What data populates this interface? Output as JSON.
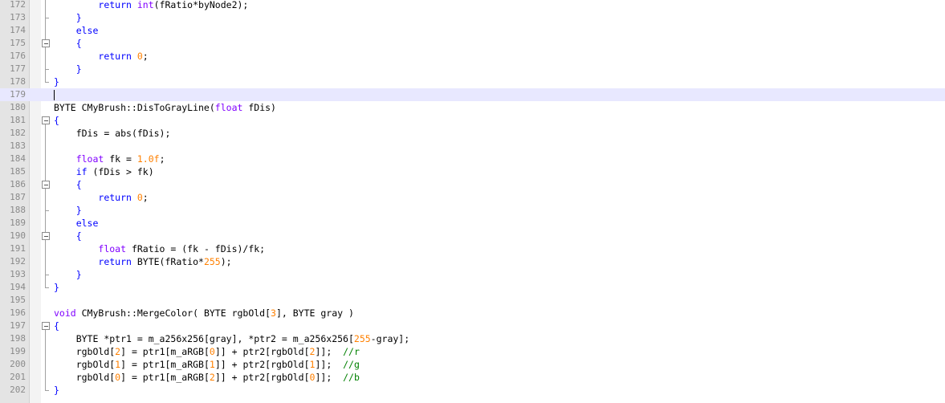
{
  "colors": {
    "keyword": "#0000ff",
    "type_keyword": "#8000ff",
    "number": "#ff8000",
    "comment": "#008000",
    "current_line": "#e8e8ff",
    "gutter": "#e4e4e4"
  },
  "current_line_number": "179",
  "lines": [
    {
      "n": "172",
      "fold": "line",
      "indent": "        ",
      "tokens": [
        {
          "t": "return ",
          "c": "kw"
        },
        {
          "t": "int",
          "c": "kwt"
        },
        {
          "t": "(fRatio*byNode2);",
          "c": "plain"
        }
      ]
    },
    {
      "n": "173",
      "fold": "end",
      "indent": "    ",
      "tokens": [
        {
          "t": "}",
          "c": "kw"
        }
      ]
    },
    {
      "n": "174",
      "fold": "line",
      "indent": "    ",
      "tokens": [
        {
          "t": "else",
          "c": "kw"
        }
      ]
    },
    {
      "n": "175",
      "fold": "box",
      "indent": "    ",
      "tokens": [
        {
          "t": "{",
          "c": "kw"
        }
      ]
    },
    {
      "n": "176",
      "fold": "line",
      "indent": "        ",
      "tokens": [
        {
          "t": "return ",
          "c": "kw"
        },
        {
          "t": "0",
          "c": "num"
        },
        {
          "t": ";",
          "c": "plain"
        }
      ]
    },
    {
      "n": "177",
      "fold": "end",
      "indent": "    ",
      "tokens": [
        {
          "t": "}",
          "c": "kw"
        }
      ]
    },
    {
      "n": "178",
      "fold": "endtop",
      "indent": "",
      "tokens": [
        {
          "t": "}",
          "c": "kw"
        }
      ]
    },
    {
      "n": "179",
      "fold": "none",
      "indent": "",
      "tokens": []
    },
    {
      "n": "180",
      "fold": "none",
      "indent": "",
      "tokens": [
        {
          "t": "BYTE CMyBrush::DisToGrayLine(",
          "c": "plain"
        },
        {
          "t": "float",
          "c": "kwt"
        },
        {
          "t": " fDis)",
          "c": "plain"
        }
      ]
    },
    {
      "n": "181",
      "fold": "boxtop",
      "indent": "",
      "tokens": [
        {
          "t": "{",
          "c": "kw"
        }
      ]
    },
    {
      "n": "182",
      "fold": "line",
      "indent": "    ",
      "tokens": [
        {
          "t": "fDis = abs(fDis);",
          "c": "plain"
        }
      ]
    },
    {
      "n": "183",
      "fold": "line",
      "indent": "",
      "tokens": []
    },
    {
      "n": "184",
      "fold": "line",
      "indent": "    ",
      "tokens": [
        {
          "t": "float",
          "c": "kwt"
        },
        {
          "t": " fk = ",
          "c": "plain"
        },
        {
          "t": "1.0f",
          "c": "num"
        },
        {
          "t": ";",
          "c": "plain"
        }
      ]
    },
    {
      "n": "185",
      "fold": "line",
      "indent": "    ",
      "tokens": [
        {
          "t": "if",
          "c": "kw"
        },
        {
          "t": " (fDis > fk)",
          "c": "plain"
        }
      ]
    },
    {
      "n": "186",
      "fold": "box",
      "indent": "    ",
      "tokens": [
        {
          "t": "{",
          "c": "kw"
        }
      ]
    },
    {
      "n": "187",
      "fold": "line",
      "indent": "        ",
      "tokens": [
        {
          "t": "return ",
          "c": "kw"
        },
        {
          "t": "0",
          "c": "num"
        },
        {
          "t": ";",
          "c": "plain"
        }
      ]
    },
    {
      "n": "188",
      "fold": "end",
      "indent": "    ",
      "tokens": [
        {
          "t": "}",
          "c": "kw"
        }
      ]
    },
    {
      "n": "189",
      "fold": "line",
      "indent": "    ",
      "tokens": [
        {
          "t": "else",
          "c": "kw"
        }
      ]
    },
    {
      "n": "190",
      "fold": "box",
      "indent": "    ",
      "tokens": [
        {
          "t": "{",
          "c": "kw"
        }
      ]
    },
    {
      "n": "191",
      "fold": "line",
      "indent": "        ",
      "tokens": [
        {
          "t": "float",
          "c": "kwt"
        },
        {
          "t": " fRatio = (fk - fDis)/fk;",
          "c": "plain"
        }
      ]
    },
    {
      "n": "192",
      "fold": "line",
      "indent": "        ",
      "tokens": [
        {
          "t": "return",
          "c": "kw"
        },
        {
          "t": " BYTE(fRatio*",
          "c": "plain"
        },
        {
          "t": "255",
          "c": "num"
        },
        {
          "t": ");",
          "c": "plain"
        }
      ]
    },
    {
      "n": "193",
      "fold": "end",
      "indent": "    ",
      "tokens": [
        {
          "t": "}",
          "c": "kw"
        }
      ]
    },
    {
      "n": "194",
      "fold": "endtop",
      "indent": "",
      "tokens": [
        {
          "t": "}",
          "c": "kw"
        }
      ]
    },
    {
      "n": "195",
      "fold": "none",
      "indent": "",
      "tokens": []
    },
    {
      "n": "196",
      "fold": "none",
      "indent": "",
      "tokens": [
        {
          "t": "void",
          "c": "kwt"
        },
        {
          "t": " CMyBrush::MergeColor( BYTE rgbOld[",
          "c": "plain"
        },
        {
          "t": "3",
          "c": "num"
        },
        {
          "t": "], BYTE gray )",
          "c": "plain"
        }
      ]
    },
    {
      "n": "197",
      "fold": "boxtop",
      "indent": "",
      "tokens": [
        {
          "t": "{",
          "c": "kw"
        }
      ]
    },
    {
      "n": "198",
      "fold": "line",
      "indent": "    ",
      "tokens": [
        {
          "t": "BYTE *ptr1 = m_a256x256[gray], *ptr2 = m_a256x256[",
          "c": "plain"
        },
        {
          "t": "255",
          "c": "num"
        },
        {
          "t": "-gray];",
          "c": "plain"
        }
      ]
    },
    {
      "n": "199",
      "fold": "line",
      "indent": "    ",
      "tokens": [
        {
          "t": "rgbOld[",
          "c": "plain"
        },
        {
          "t": "2",
          "c": "num"
        },
        {
          "t": "] = ptr1[m_aRGB[",
          "c": "plain"
        },
        {
          "t": "0",
          "c": "num"
        },
        {
          "t": "]] + ptr2[rgbOld[",
          "c": "plain"
        },
        {
          "t": "2",
          "c": "num"
        },
        {
          "t": "]];  ",
          "c": "plain"
        },
        {
          "t": "//r",
          "c": "cmt"
        }
      ]
    },
    {
      "n": "200",
      "fold": "line",
      "indent": "    ",
      "tokens": [
        {
          "t": "rgbOld[",
          "c": "plain"
        },
        {
          "t": "1",
          "c": "num"
        },
        {
          "t": "] = ptr1[m_aRGB[",
          "c": "plain"
        },
        {
          "t": "1",
          "c": "num"
        },
        {
          "t": "]] + ptr2[rgbOld[",
          "c": "plain"
        },
        {
          "t": "1",
          "c": "num"
        },
        {
          "t": "]];  ",
          "c": "plain"
        },
        {
          "t": "//g",
          "c": "cmt"
        }
      ]
    },
    {
      "n": "201",
      "fold": "line",
      "indent": "    ",
      "tokens": [
        {
          "t": "rgbOld[",
          "c": "plain"
        },
        {
          "t": "0",
          "c": "num"
        },
        {
          "t": "] = ptr1[m_aRGB[",
          "c": "plain"
        },
        {
          "t": "2",
          "c": "num"
        },
        {
          "t": "]] + ptr2[rgbOld[",
          "c": "plain"
        },
        {
          "t": "0",
          "c": "num"
        },
        {
          "t": "]];  ",
          "c": "plain"
        },
        {
          "t": "//b",
          "c": "cmt"
        }
      ]
    },
    {
      "n": "202",
      "fold": "endtop",
      "indent": "",
      "tokens": [
        {
          "t": "}",
          "c": "kw"
        }
      ]
    }
  ]
}
